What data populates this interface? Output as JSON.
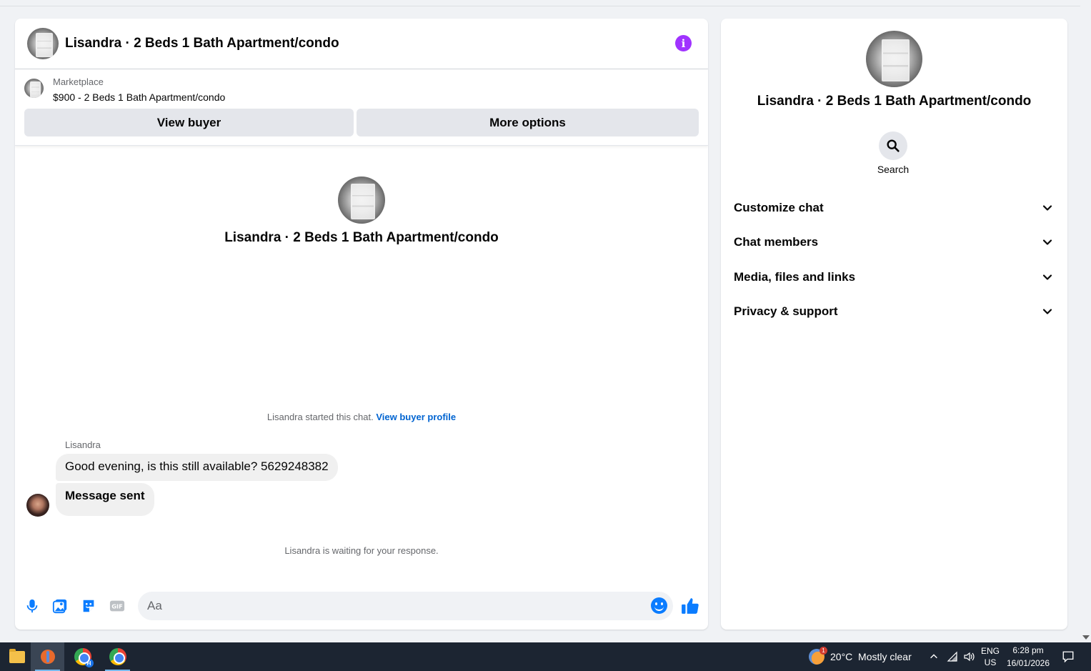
{
  "chat": {
    "title": "Lisandra · 2 Beds 1 Bath Apartment/condo",
    "marketplace_label": "Marketplace",
    "listing": "$900 - 2 Beds 1 Bath Apartment/condo",
    "view_buyer_label": "View buyer",
    "more_options_label": "More options",
    "profile_name": "Lisandra · 2 Beds 1 Bath Apartment/condo",
    "started_text": "Lisandra started this chat.",
    "view_buyer_profile_link": "View buyer profile",
    "sender_name": "Lisandra",
    "messages": [
      {
        "text": "Good evening, is this still available? 5629248382"
      },
      {
        "text": "Message sent"
      }
    ],
    "waiting_text": "Lisandra is waiting for your response.",
    "composer_placeholder": "Aa"
  },
  "side": {
    "name": "Lisandra · 2 Beds 1 Bath Apartment/condo",
    "search_label": "Search",
    "menu": [
      {
        "label": "Customize chat"
      },
      {
        "label": "Chat members"
      },
      {
        "label": "Media, files and links"
      },
      {
        "label": "Privacy & support"
      }
    ]
  },
  "taskbar": {
    "weather_badge": "1",
    "weather": "20°C  Mostly clear",
    "lang_top": "ENG",
    "lang_bottom": "US",
    "time": "6:28 pm",
    "date": "16/01/2026",
    "chrome_badge": "H"
  },
  "colors": {
    "accent_blue": "#0a7cff",
    "info_purple": "#a033ff",
    "link_blue": "#0064d1",
    "taskbar_bg": "#1c2532"
  }
}
